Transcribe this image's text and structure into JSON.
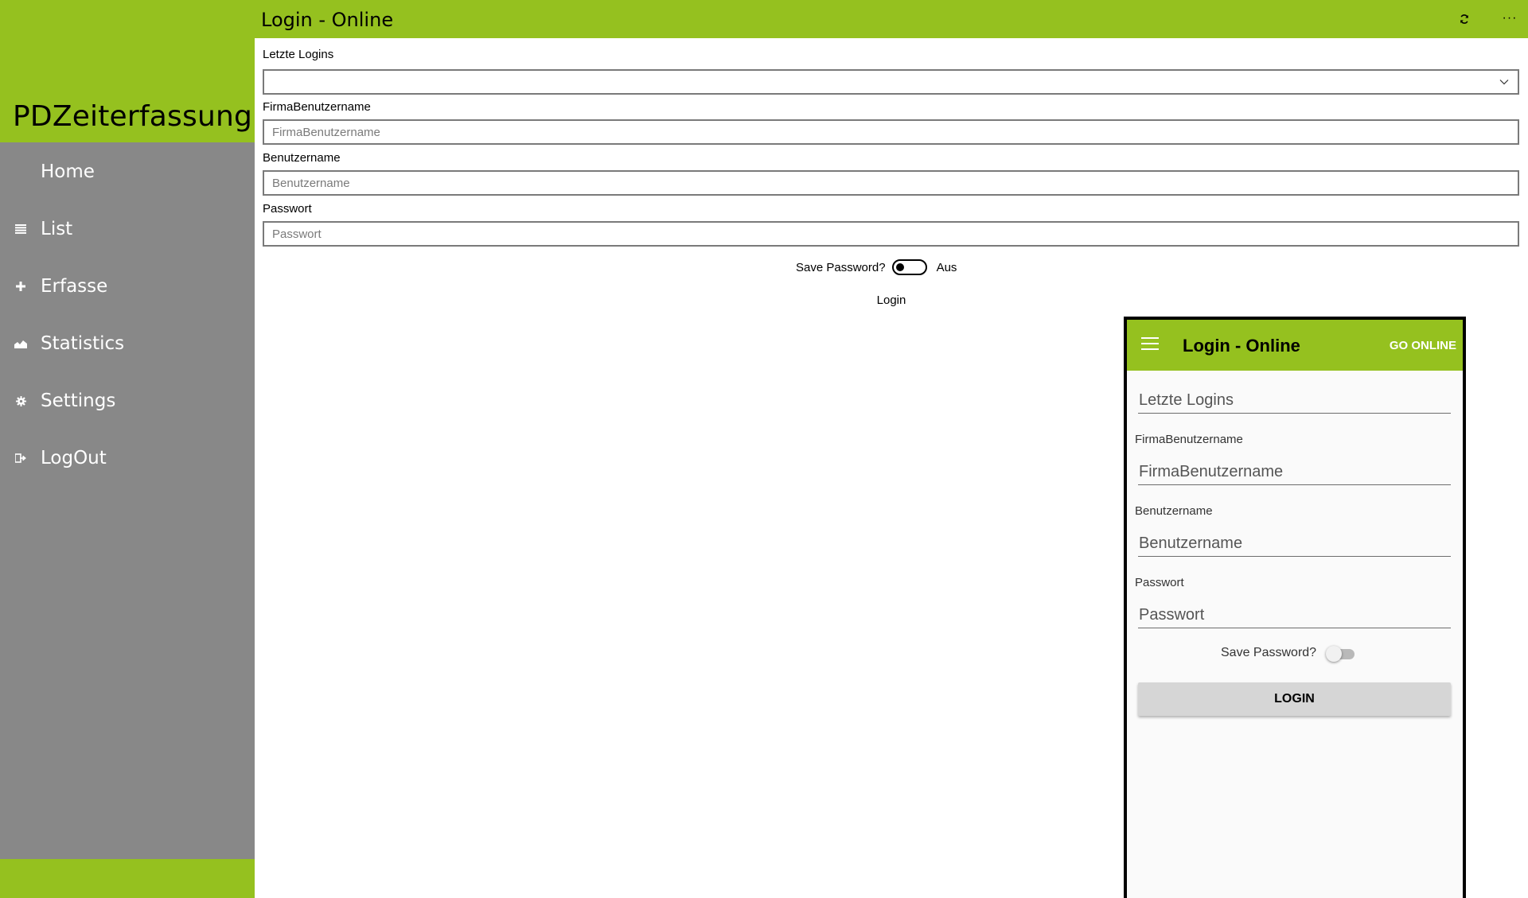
{
  "sidebar": {
    "app_title": "PDZeiterfassung",
    "items": [
      {
        "label": "Home",
        "icon": "home-icon"
      },
      {
        "label": "List",
        "icon": "list-icon"
      },
      {
        "label": "Erfasse",
        "icon": "plus-icon"
      },
      {
        "label": "Statistics",
        "icon": "chart-icon"
      },
      {
        "label": "Settings",
        "icon": "gear-icon"
      },
      {
        "label": "LogOut",
        "icon": "logout-icon"
      }
    ]
  },
  "header": {
    "title": "Login - Online",
    "more_label": "···"
  },
  "form": {
    "recent_logins_label": "Letzte Logins",
    "recent_logins_value": "",
    "company_user_label": "FirmaBenutzername",
    "company_user_placeholder": "FirmaBenutzername",
    "username_label": "Benutzername",
    "username_placeholder": "Benutzername",
    "password_label": "Passwort",
    "password_placeholder": "Passwort",
    "save_password_label": "Save Password?",
    "save_password_state": "Aus",
    "login_label": "Login"
  },
  "phone": {
    "title": "Login - Online",
    "go_online_label": "GO ONLINE",
    "recent_logins_placeholder": "Letzte Logins",
    "company_user_label": "FirmaBenutzername",
    "company_user_placeholder": "FirmaBenutzername",
    "username_label": "Benutzername",
    "username_placeholder": "Benutzername",
    "password_label": "Passwort",
    "password_placeholder": "Passwort",
    "save_password_label": "Save Password?",
    "login_label": "LOGIN"
  },
  "colors": {
    "accent": "#95c11f",
    "sidebar_bg": "#888888",
    "nav_text": "#ffffff"
  }
}
